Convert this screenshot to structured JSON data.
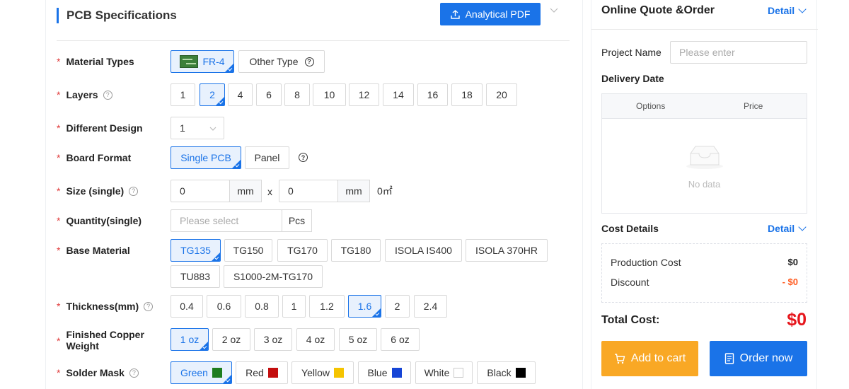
{
  "header": {
    "title": "PCB Specifications",
    "pdf_button": "Analytical PDF"
  },
  "material": {
    "label": "Material Types",
    "options": [
      "FR-4",
      "Other Type"
    ]
  },
  "layers": {
    "label": "Layers",
    "options": [
      "1",
      "2",
      "4",
      "6",
      "8",
      "10",
      "12",
      "14",
      "16",
      "18",
      "20"
    ],
    "selected": "2"
  },
  "design": {
    "label": "Different Design",
    "value": "1"
  },
  "format": {
    "label": "Board Format",
    "options": [
      "Single PCB",
      "Panel"
    ]
  },
  "size": {
    "label": "Size (single)",
    "width": "0",
    "height": "0",
    "unit": "mm",
    "separator": "x",
    "area": "0㎡"
  },
  "quantity": {
    "label": "Quantity(single)",
    "placeholder": "Please select",
    "unit": "Pcs"
  },
  "base": {
    "label": "Base Material",
    "options": [
      "TG135",
      "TG150",
      "TG170",
      "TG180",
      "ISOLA IS400",
      "ISOLA 370HR",
      "TU883",
      "S1000-2M-TG170"
    ],
    "selected": "TG135"
  },
  "thickness": {
    "label": "Thickness(mm)",
    "options": [
      "0.4",
      "0.6",
      "0.8",
      "1",
      "1.2",
      "1.6",
      "2",
      "2.4"
    ],
    "selected": "1.6"
  },
  "copper": {
    "label_line1": "Finished Copper",
    "label_line2": "Weight",
    "options": [
      "1 oz",
      "2 oz",
      "3 oz",
      "4 oz",
      "5 oz",
      "6 oz"
    ],
    "selected": "1 oz"
  },
  "mask": {
    "label": "Solder Mask",
    "options": [
      "Green",
      "Red",
      "Yellow",
      "Blue",
      "White",
      "Black"
    ],
    "colors": [
      "#1e7d1e",
      "#c40e0e",
      "#f5c400",
      "#1645d6",
      "#ffffff",
      "#000000"
    ],
    "selected": "Green"
  },
  "quote": {
    "title": "Online Quote &Order",
    "detail": "Detail",
    "project_label": "Project Name",
    "project_placeholder": "Please enter",
    "delivery_label": "Delivery Date",
    "col_options": "Options",
    "col_price": "Price",
    "no_data": "No data",
    "cost_title": "Cost Details",
    "production_label": "Production Cost",
    "production_value": "$0",
    "discount_label": "Discount",
    "discount_value": "- $0",
    "total_label": "Total Cost:",
    "total_value": "$0",
    "cart_button": "Add to cart",
    "order_button": "Order now"
  },
  "icons": {
    "upload": "upload-icon",
    "cart": "cart-icon",
    "order": "order-icon",
    "help": "help-icon",
    "empty": "empty-box-icon"
  }
}
